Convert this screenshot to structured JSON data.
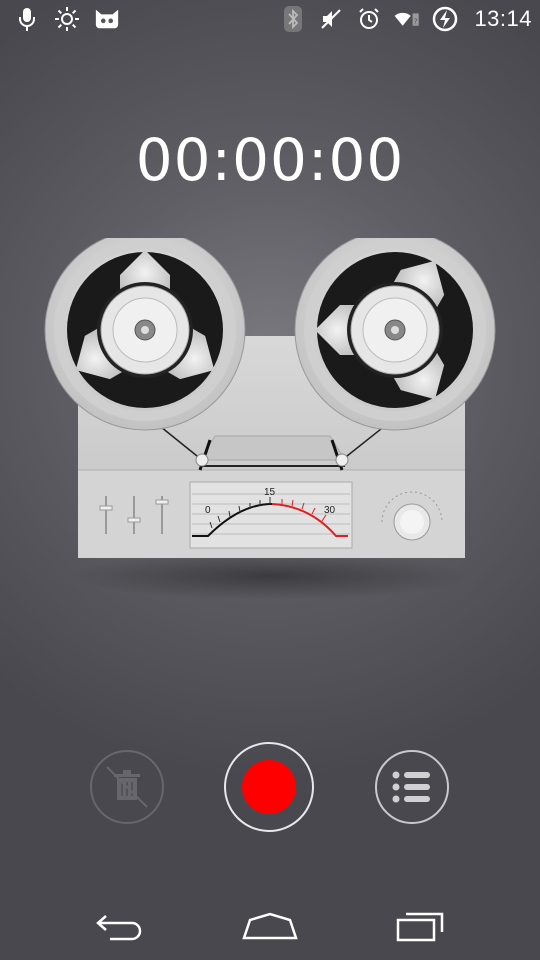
{
  "status_bar": {
    "clock": "13:14",
    "icons": [
      "microphone-icon",
      "brightness-icon",
      "cyanogen-icon",
      "bluetooth-icon",
      "mute-icon",
      "alarm-icon",
      "wifi-icon",
      "battery-charging-icon"
    ]
  },
  "recorder": {
    "timer": "00:00:00",
    "meter": {
      "scale_min": "0",
      "scale_mid": "15",
      "scale_max": "30"
    }
  },
  "controls": {
    "delete_icon": "trash-icon",
    "record_icon": "record-icon",
    "list_icon": "list-icon",
    "record_color": "#ff0000"
  },
  "nav": {
    "back": "back-icon",
    "home": "home-icon",
    "recents": "recents-icon"
  }
}
